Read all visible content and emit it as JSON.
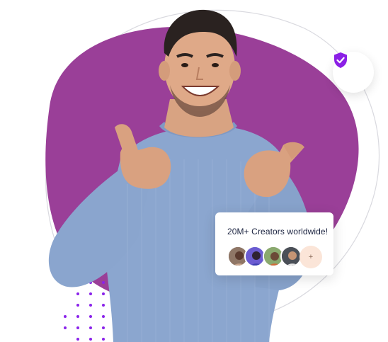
{
  "hero": {
    "blob_color": "#9a3f98",
    "accent_color": "#8a22ea"
  },
  "badge": {
    "icon": "shield-check-icon",
    "color": "#8b1fe6"
  },
  "creators": {
    "title": "20M+ Creators worldwide!",
    "more_label": "+",
    "avatars": [
      "avatar-1",
      "avatar-2",
      "avatar-3",
      "avatar-4"
    ]
  }
}
